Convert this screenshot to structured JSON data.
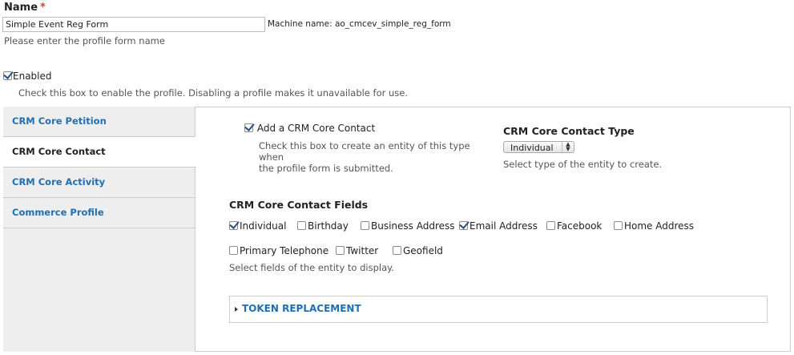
{
  "name_field": {
    "label": "Name",
    "required_mark": "*",
    "value": "Simple Event Reg Form",
    "machine_name": "Machine name: ao_cmcev_simple_reg_form",
    "help": "Please enter the profile form name"
  },
  "enabled": {
    "label": "Enabled",
    "checked": true,
    "help": "Check this box to enable the profile. Disabling a profile makes it unavailable for use."
  },
  "tabs": [
    {
      "label": "CRM Core Petition",
      "active": false
    },
    {
      "label": "CRM Core Contact",
      "active": true
    },
    {
      "label": "CRM Core Activity",
      "active": false
    },
    {
      "label": "Commerce Profile",
      "active": false
    }
  ],
  "contact": {
    "add_label": "Add a CRM Core Contact",
    "add_checked": true,
    "add_help_line1": "Check this box to create an entity of this type when",
    "add_help_line2": "the profile form is submitted.",
    "type_title": "CRM Core Contact Type",
    "type_selected": "Individual",
    "type_help": "Select type of the entity to create.",
    "fields_title": "CRM Core Contact Fields",
    "fields": [
      {
        "label": "Individual",
        "checked": true
      },
      {
        "label": "Birthday",
        "checked": false
      },
      {
        "label": "Business Address",
        "checked": false
      },
      {
        "label": "Email Address",
        "checked": true
      },
      {
        "label": "Facebook",
        "checked": false
      },
      {
        "label": "Home Address",
        "checked": false
      },
      {
        "label": "Primary Telephone",
        "checked": false
      },
      {
        "label": "Twitter",
        "checked": false
      },
      {
        "label": "Geofield",
        "checked": false
      }
    ],
    "fields_help": "Select fields of the entity to display.",
    "token_label": "TOKEN REPLACEMENT"
  },
  "colors": {
    "link": "#1f6fb2",
    "required": "#e3392b",
    "sidebar_bg": "#eeeeee"
  }
}
